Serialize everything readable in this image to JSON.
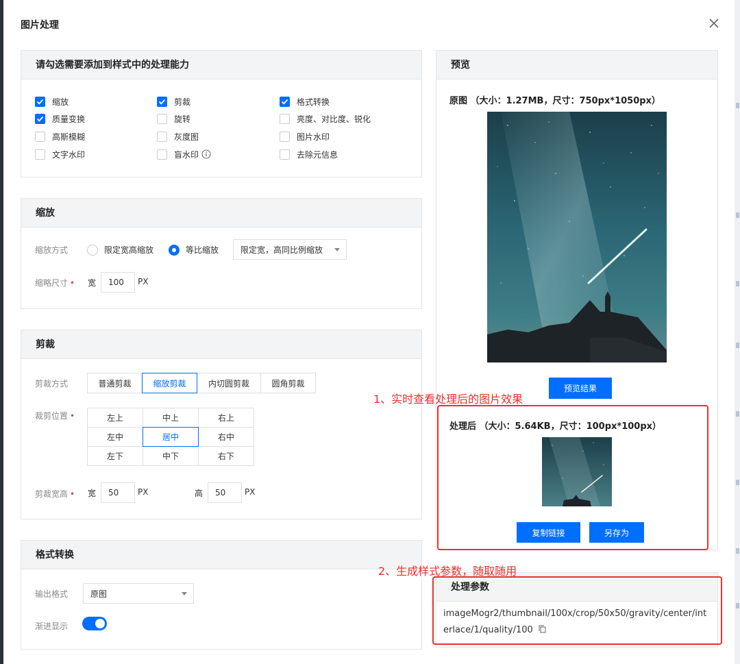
{
  "dialog": {
    "title": "图片处理"
  },
  "capabilities": {
    "title": "请勾选需要添加到样式中的处理能力",
    "items": [
      {
        "label": "缩放",
        "checked": true
      },
      {
        "label": "剪裁",
        "checked": true
      },
      {
        "label": "格式转换",
        "checked": true
      },
      {
        "label": "质量变换",
        "checked": true
      },
      {
        "label": "旋转",
        "checked": false
      },
      {
        "label": "亮度、对比度、锐化",
        "checked": false
      },
      {
        "label": "高斯模糊",
        "checked": false
      },
      {
        "label": "灰度图",
        "checked": false
      },
      {
        "label": "图片水印",
        "checked": false
      },
      {
        "label": "文字水印",
        "checked": false
      },
      {
        "label": "盲水印",
        "checked": false
      },
      {
        "label": "去除元信息",
        "checked": false
      }
    ]
  },
  "scale": {
    "title": "缩放",
    "method_label": "缩放方式",
    "option_fixed": "限定宽高缩放",
    "option_ratio": "等比缩放",
    "selected": "等比缩放",
    "ratio_select": "限定宽，高同比例缩放",
    "size_label": "缩略尺寸",
    "width_label": "宽",
    "width_value": "100",
    "unit": "PX"
  },
  "crop": {
    "title": "剪裁",
    "method_label": "剪裁方式",
    "methods": [
      "普通剪裁",
      "缩放剪裁",
      "内切圆剪裁",
      "圆角剪裁"
    ],
    "active_method": "缩放剪裁",
    "position_label": "裁剪位置",
    "positions": [
      "左上",
      "中上",
      "右上",
      "左中",
      "居中",
      "右中",
      "左下",
      "中下",
      "右下"
    ],
    "active_position": "居中",
    "size_label": "剪裁宽高",
    "width_label": "宽",
    "width_value": "50",
    "height_label": "高",
    "height_value": "50",
    "unit": "PX"
  },
  "format": {
    "title": "格式转换",
    "output_label": "输出格式",
    "output_value": "原图",
    "progressive_label": "渐进显示",
    "progressive_on": true
  },
  "preview": {
    "title": "预览",
    "original_caption": "原图 （大小：1.27MB，尺寸：750px*1050px）",
    "preview_button": "预览结果",
    "processed_caption": "处理后 （大小：5.64KB，尺寸：100px*100px）",
    "copy_link_button": "复制链接",
    "save_as_button": "另存为"
  },
  "params": {
    "title": "处理参数",
    "value": "imageMogr2/thumbnail/100x/crop/50x50/gravity/center/interlace/1/quality/100"
  },
  "annotations": {
    "first": "1、实时查看处理后的图片效果",
    "second": "2、生成样式参数，随取随用"
  },
  "colors": {
    "primary": "#006eff",
    "annotation": "#e8322b"
  }
}
